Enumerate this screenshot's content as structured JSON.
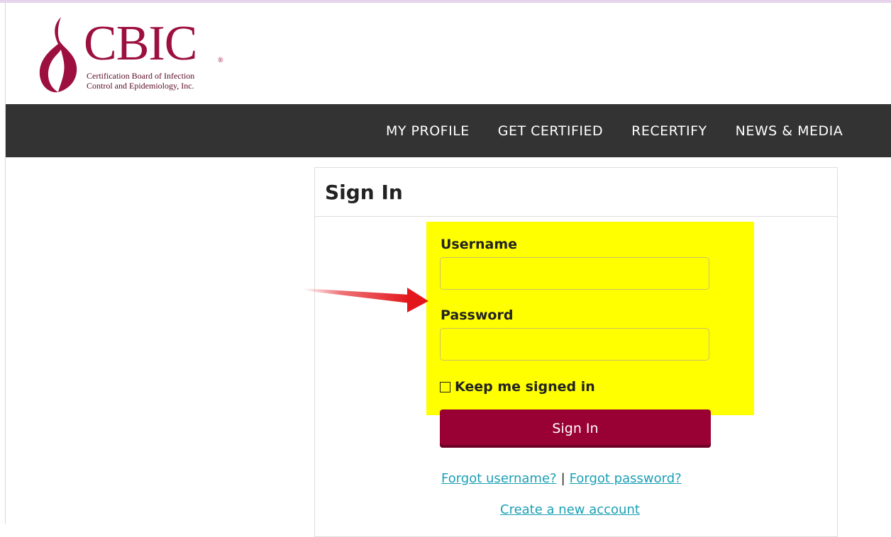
{
  "logo": {
    "name": "CBIC",
    "registered": "®",
    "subtitle_line1": "Certification Board of Infection",
    "subtitle_line2": "Control and Epidemiology, Inc."
  },
  "nav": {
    "items": [
      "MY PROFILE",
      "GET CERTIFIED",
      "RECERTIFY",
      "NEWS & MEDIA"
    ]
  },
  "signin": {
    "title": "Sign In",
    "username_label": "Username",
    "username_value": "",
    "password_label": "Password",
    "password_value": "",
    "keep_signed_in_label": "Keep me signed in",
    "keep_signed_in_checked": false,
    "submit_label": "Sign In",
    "forgot_username": "Forgot username?",
    "separator": "|",
    "forgot_password": "Forgot password?",
    "create_account": "Create a new account"
  },
  "colors": {
    "brand": "#990033",
    "nav_bg": "#333333",
    "highlight": "#ffff00",
    "link": "#1a9fb5",
    "annotation_arrow": "#e3161c"
  }
}
